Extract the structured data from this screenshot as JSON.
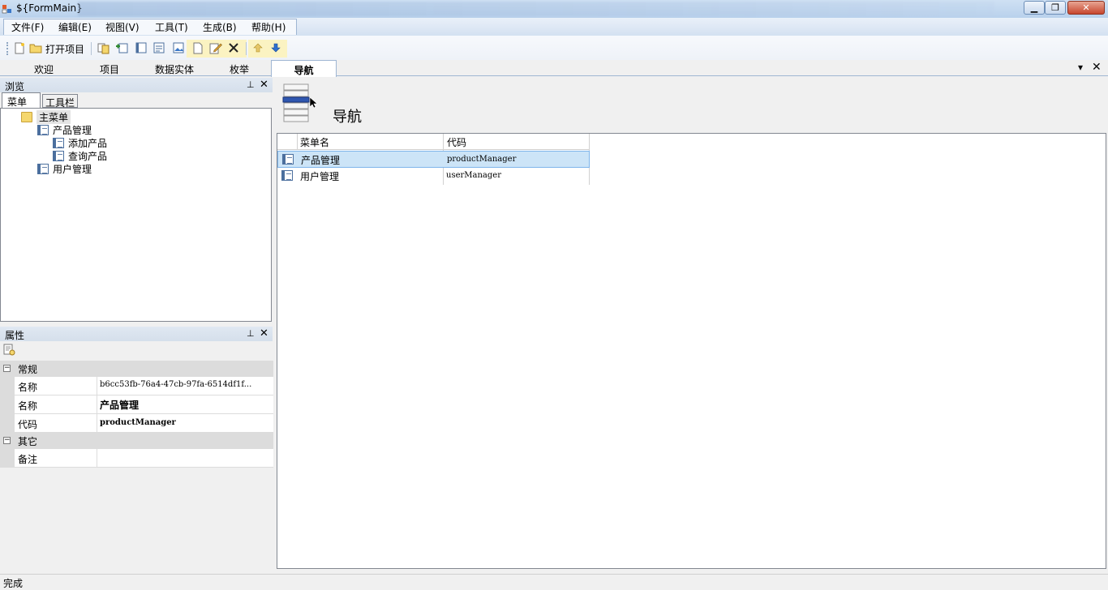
{
  "window": {
    "title": "${FormMain}"
  },
  "menu": [
    "文件(F)",
    "编辑(E)",
    "视图(V)",
    "工具(T)",
    "生成(B)",
    "帮助(H)"
  ],
  "toolbar": {
    "open_project": "打开项目"
  },
  "doc_tabs": [
    "欢迎",
    "项目",
    "数据实体",
    "枚举"
  ],
  "doc_tab_active": "导航",
  "browse_panel": {
    "title": "浏览",
    "tabs": [
      "菜单",
      "工具栏"
    ],
    "tree": {
      "root": "主菜单",
      "product": "产品管理",
      "add_product": "添加产品",
      "query_product": "查询产品",
      "user": "用户管理"
    }
  },
  "props_panel": {
    "title": "属性",
    "categories": {
      "general": "常规",
      "other": "其它"
    },
    "rows": [
      {
        "name": "名称",
        "value": "b6cc53fb-76a4-47cb-97fa-6514df1f..."
      },
      {
        "name": "名称",
        "value": "产品管理"
      },
      {
        "name": "代码",
        "value": "productManager"
      },
      {
        "name": "备注",
        "value": ""
      }
    ]
  },
  "nav": {
    "title": "导航",
    "columns": [
      "菜单名",
      "代码"
    ],
    "rows": [
      {
        "name": "产品管理",
        "code": "productManager"
      },
      {
        "name": "用户管理",
        "code": "userManager"
      }
    ]
  },
  "status": "完成"
}
